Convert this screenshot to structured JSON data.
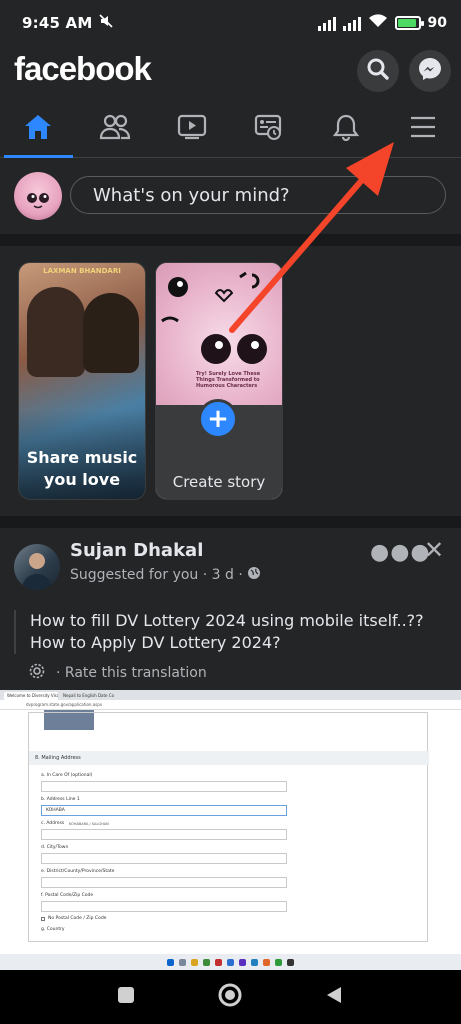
{
  "status_bar": {
    "time": "9:45 AM",
    "battery_pct": "90",
    "battery_level": 0.9
  },
  "header": {
    "logo": "facebook",
    "icons": [
      "search-icon",
      "messenger-icon"
    ]
  },
  "tabs": [
    {
      "name": "home",
      "icon": "home-icon",
      "active": true
    },
    {
      "name": "friends",
      "icon": "friends-icon",
      "active": false
    },
    {
      "name": "watch",
      "icon": "video-icon",
      "active": false
    },
    {
      "name": "marketplace",
      "icon": "feeds-icon",
      "active": false
    },
    {
      "name": "notifications",
      "icon": "bell-icon",
      "active": false
    },
    {
      "name": "menu",
      "icon": "hamburger-menu-icon",
      "active": false
    }
  ],
  "composer": {
    "placeholder": "What's on your mind?"
  },
  "stories": [
    {
      "label": "Share music you love",
      "banner": "LAXMAN BHANDARI"
    },
    {
      "label": "Create story",
      "caption": "Try! Surely Love These Things Transformed to Humorous Characters"
    }
  ],
  "post": {
    "author": "Sujan Dhakal",
    "meta": "Suggested for you · 3 d ·",
    "text_line1": "How to fill DV Lottery 2024 using mobile itself..??",
    "text_line2": "How to Apply DV Lottery 2024?",
    "translate": "Rate this translation",
    "screenshot": {
      "tab1": "Welcome to Diversity Visa Program",
      "tab2": "Nepali to English Date Convert",
      "url": "dvprogram.state.gov/application.aspx",
      "section": "8. Mailing Address",
      "fields": [
        {
          "label": "a. In Care Of (optional)",
          "value": ""
        },
        {
          "label": "b. Address Line 1",
          "value": "KOHABA"
        },
        {
          "label": "c. Address",
          "value": ""
        },
        {
          "label": "d. City/Town",
          "value": ""
        },
        {
          "label": "e. District/County/Province/State",
          "value": ""
        },
        {
          "label": "f. Postal Code/Zip Code",
          "value": ""
        },
        {
          "label": "g. Country",
          "value": ""
        }
      ],
      "no_postal": "No Postal Code / Zip Code",
      "suggestion": "KOHABARA / SALGHAN"
    }
  },
  "colors": {
    "accent": "#2d88ff",
    "surface": "#242526",
    "background": "#18191a",
    "annotation_arrow": "#f4442a"
  }
}
